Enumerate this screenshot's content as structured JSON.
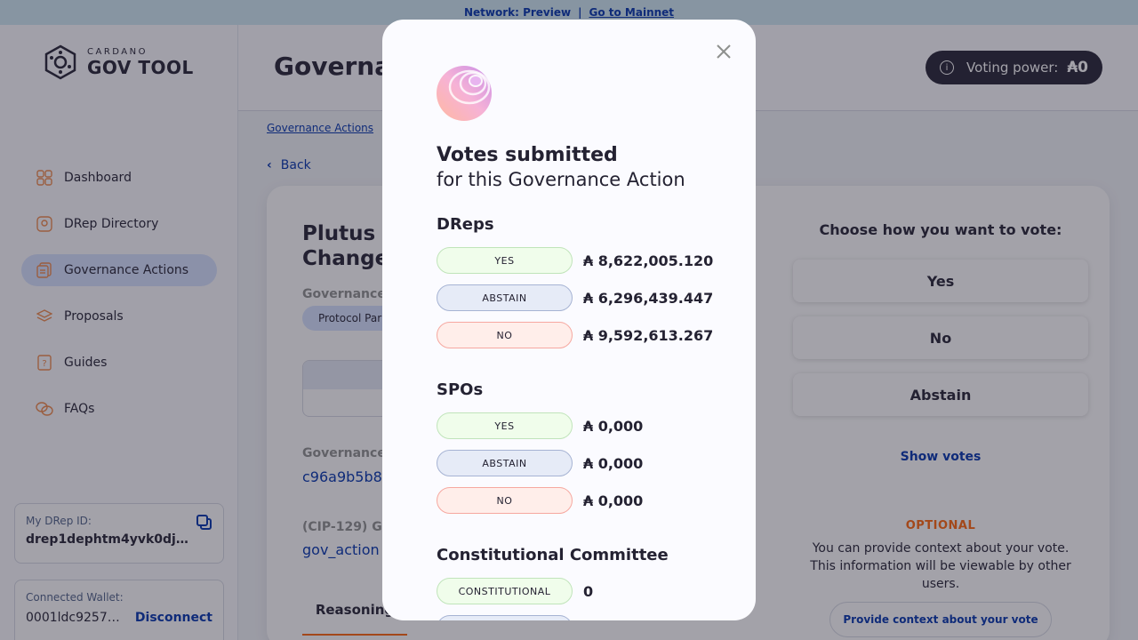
{
  "banner": {
    "network": "Network: Preview",
    "separator": "|",
    "mainnet_link": "Go to Mainnet"
  },
  "logo": {
    "small": "CARDANO",
    "big": "GOV TOOL"
  },
  "sidebar": {
    "items": [
      {
        "label": "Dashboard",
        "icon": "dashboard-icon"
      },
      {
        "label": "DRep Directory",
        "icon": "drep-directory-icon"
      },
      {
        "label": "Governance Actions",
        "icon": "governance-actions-icon"
      },
      {
        "label": "Proposals",
        "icon": "proposals-icon"
      },
      {
        "label": "Guides",
        "icon": "guides-icon"
      },
      {
        "label": "FAQs",
        "icon": "faqs-icon"
      }
    ],
    "active_index": 2,
    "drep": {
      "label": "My DRep ID:",
      "value": "drep1dephtm4yvk0dj502zg…"
    },
    "wallet": {
      "label": "Connected Wallet:",
      "address": "0001ldc92570…",
      "disconnect": "Disconnect"
    }
  },
  "header": {
    "title": "Governa",
    "voting_power_label": "Voting power:",
    "voting_power_value": "₳0"
  },
  "breadcrumb": "Governance Actions",
  "back_label": "Back",
  "card": {
    "title": "Plutus V Change",
    "type_label": "Governance",
    "type_chip": "Protocol Par",
    "id_label": "Governance",
    "id_value": "c96a9b5b8",
    "cip_label": "(CIP-129) Go",
    "cip_value": "gov_action",
    "tab_reasoning": "Reasoning"
  },
  "vote_panel": {
    "question": "Choose how you want to vote:",
    "options": [
      "Yes",
      "No",
      "Abstain"
    ],
    "show_votes": "Show votes",
    "optional": "OPTIONAL",
    "context_text": "You can provide context about your vote. This information will be viewable by other users.",
    "context_button": "Provide context about your vote"
  },
  "modal": {
    "title": "Votes submitted",
    "subtitle": "for this Governance Action",
    "dreps": {
      "heading": "DReps",
      "rows": [
        {
          "label": "YES",
          "amount": "₳ 8,622,005.120"
        },
        {
          "label": "ABSTAIN",
          "amount": "₳ 6,296,439.447"
        },
        {
          "label": "NO",
          "amount": "₳ 9,592,613.267"
        }
      ]
    },
    "spos": {
      "heading": "SPOs",
      "rows": [
        {
          "label": "YES",
          "amount": "₳ 0,000"
        },
        {
          "label": "ABSTAIN",
          "amount": "₳ 0,000"
        },
        {
          "label": "NO",
          "amount": "₳ 0,000"
        }
      ]
    },
    "cc": {
      "heading": "Constitutional Committee",
      "rows": [
        {
          "label": "CONSTITUTIONAL",
          "amount": "0"
        },
        {
          "label": "",
          "amount": ""
        }
      ]
    }
  },
  "colors": {
    "accent": "#0033ad",
    "orange": "#ff640a",
    "dark": "#242232"
  }
}
